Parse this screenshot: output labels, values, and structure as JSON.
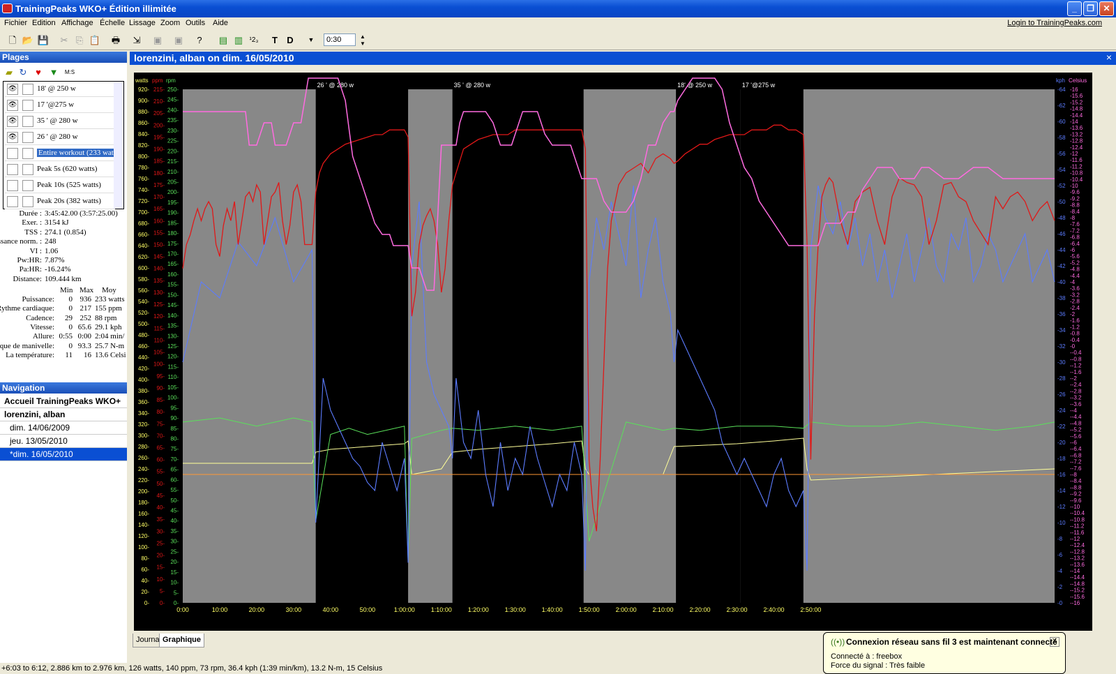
{
  "window": {
    "title": "TrainingPeaks WKO+ Édition illimitée",
    "buttons": [
      "_",
      "❐",
      "✕"
    ]
  },
  "menu": {
    "items": [
      "Fichier",
      "Edition",
      "Affichage",
      "Échelle",
      "Lissage",
      "Zoom",
      "Outils",
      "Aide"
    ],
    "login": "Login to TrainingPeaks.com"
  },
  "toolbar": {
    "zoom_value": "0:30",
    "text_t": "T",
    "text_d": "D",
    "num_icon": "¹2₃"
  },
  "ranges": {
    "title": "Plages",
    "tool_ms": "M:S",
    "items": [
      {
        "label": "18' @ 250 w",
        "eye": "👁"
      },
      {
        "label": "17 '@275 w",
        "eye": "👁"
      },
      {
        "label": "35 ' @ 280 w",
        "eye": "👁"
      },
      {
        "label": "26 ' @ 280 w",
        "eye": "👁"
      },
      {
        "label": "Entire workout (233 watt",
        "eye": ""
      },
      {
        "label": "Peak 5s (620 watts)",
        "eye": ""
      },
      {
        "label": "Peak 10s (525 watts)",
        "eye": ""
      },
      {
        "label": "Peak 20s (382 watts)",
        "eye": ""
      }
    ]
  },
  "summary": [
    {
      "label": "Durée :",
      "value": "3:45:42.00 (3:57:25.00)"
    },
    {
      "label": "Exer. :",
      "value": "3154 kJ"
    },
    {
      "label": "TSS :",
      "value": "274.1 (0.854)"
    },
    {
      "label": "ssance norm. :",
      "value": "248"
    },
    {
      "label": "VI :",
      "value": "1.06"
    },
    {
      "label": "Pw:HR:",
      "value": "7.87%"
    },
    {
      "label": "Pa:HR:",
      "value": "-16.24%"
    },
    {
      "label": "Distance:",
      "value": "109.444 km"
    }
  ],
  "stats": {
    "headers": [
      "Min",
      "Max",
      "Moy"
    ],
    "rows": [
      {
        "label": "Puissance:",
        "min": "0",
        "max": "936",
        "avg": "233 watts"
      },
      {
        "label": "Rythme cardiaque:",
        "min": "0",
        "max": "217",
        "avg": "155 ppm"
      },
      {
        "label": "Cadence:",
        "min": "29",
        "max": "252",
        "avg": "88 rpm"
      },
      {
        "label": "Vitesse:",
        "min": "0",
        "max": "65.6",
        "avg": "29.1 kph"
      },
      {
        "label": "Allure:",
        "min": "0:55",
        "max": "0:00",
        "avg": "2:04 min/"
      },
      {
        "label": "rque de manivelle:",
        "min": "0",
        "max": "93.3",
        "avg": "25.7 N-m"
      },
      {
        "label": "La température:",
        "min": "11",
        "max": "16",
        "avg": "13.6 Celsi"
      }
    ]
  },
  "navigation": {
    "title": "Navigation",
    "items": [
      "Accueil TrainingPeaks WKO+",
      "lorenzini, alban",
      "dim. 14/06/2009",
      "jeu. 13/05/2010",
      "*dim. 16/05/2010"
    ]
  },
  "chart": {
    "title": "lorenzini, alban on dim. 16/05/2010",
    "close": "×",
    "tabs": [
      "Journal",
      "Graphique"
    ]
  },
  "chart_data": {
    "type": "line",
    "colors": {
      "power": "#ff6be0",
      "hr": "#e01818",
      "cadence": "#5ae05a",
      "speed": "#5c7cff",
      "torque": "#ffff99",
      "temp": "#ff9933",
      "gray": "#888888"
    },
    "axis_units": {
      "watts": "watts",
      "ppm": "ppm",
      "rpm": "rpm",
      "kph": "kph",
      "celsius": "Celsius"
    },
    "x_ticks": [
      "0:00",
      "10:00",
      "20:00",
      "30:00",
      "40:00",
      "50:00",
      "1:00:00",
      "1:10:00",
      "1:20:00",
      "1:30:00",
      "1:40:00",
      "1:50:00",
      "2:00:00",
      "2:10:00",
      "2:20:00",
      "2:30:00",
      "2:40:00",
      "2:50:00"
    ],
    "xlim_minutes": [
      0,
      236
    ],
    "watts": {
      "min": 0,
      "max": 920,
      "step": 20
    },
    "ppm": {
      "min": 0,
      "max": 215,
      "step": 5
    },
    "rpm": {
      "min": 0,
      "max": 250,
      "step": 5
    },
    "kph": {
      "min": 0,
      "max": 64,
      "step": 2
    },
    "celsius": {
      "min": -16,
      "max": 16,
      "step": 0.2
    },
    "intervals": [
      {
        "label": "26 ' @ 280 w",
        "start": 36,
        "end": 61
      },
      {
        "label": "35 ' @ 280 w",
        "start": 73,
        "end": 108.5
      },
      {
        "label": "18' @ 250 w",
        "start": 133.5,
        "end": 151
      },
      {
        "label": "17 '@275 w",
        "start": 151,
        "end": 168
      }
    ],
    "series": {
      "power": {
        "x": [
          0,
          15,
          17,
          18,
          19,
          20,
          22,
          23,
          24,
          25,
          27,
          28,
          30,
          32,
          33,
          34,
          35,
          36,
          42,
          44,
          45,
          46,
          48,
          50,
          52,
          54,
          56,
          57,
          61,
          62,
          64,
          66,
          68,
          70,
          72,
          74,
          75,
          76,
          78,
          80,
          82,
          84,
          86,
          88,
          89,
          90,
          92,
          94,
          96,
          98,
          100,
          102,
          104,
          105,
          106,
          108,
          110,
          112,
          113,
          114,
          116,
          118,
          120,
          122,
          124,
          126,
          128,
          130,
          132,
          133,
          134,
          136,
          138,
          140,
          142,
          144,
          146,
          148,
          150,
          152,
          154,
          156,
          158,
          160,
          162,
          164,
          166,
          168,
          170,
          172,
          174,
          176,
          178,
          180,
          182,
          184,
          186,
          188,
          190,
          192,
          194,
          196,
          198,
          200,
          202,
          206,
          210,
          214,
          218,
          222,
          226,
          230,
          236
        ],
        "y": [
          880,
          880,
          880,
          820,
          820,
          820,
          860,
          860,
          860,
          820,
          820,
          820,
          860,
          860,
          900,
          940,
          940,
          940,
          940,
          900,
          850,
          800,
          760,
          720,
          680,
          660,
          660,
          640,
          640,
          600,
          600,
          560,
          560,
          820,
          820,
          820,
          860,
          880,
          880,
          880,
          880,
          860,
          820,
          820,
          820,
          840,
          880,
          880,
          880,
          840,
          820,
          820,
          820,
          820,
          800,
          760,
          760,
          760,
          740,
          720,
          700,
          700,
          700,
          720,
          760,
          820,
          820,
          860,
          880,
          880,
          900,
          920,
          940,
          940,
          940,
          940,
          920,
          860,
          820,
          780,
          760,
          720,
          700,
          680,
          660,
          640,
          640,
          640,
          640,
          640,
          680,
          680,
          680,
          700,
          700,
          740,
          760,
          780,
          780,
          780,
          760,
          760,
          760,
          780,
          780,
          760,
          760,
          780,
          780,
          760,
          760,
          760,
          760
        ]
      },
      "hr": {
        "x": [
          0,
          1,
          2,
          3,
          4,
          5,
          6,
          7,
          8,
          9,
          10,
          11,
          12,
          13,
          14,
          15,
          16,
          17,
          18,
          19,
          20,
          21,
          22,
          23,
          24,
          25,
          26,
          27,
          28,
          29,
          30,
          31,
          32,
          33,
          34,
          35,
          36,
          37,
          38,
          39,
          40,
          42,
          44,
          46,
          48,
          50,
          52,
          54,
          56,
          58,
          60,
          61,
          62,
          63,
          64,
          65,
          66,
          67,
          68,
          69,
          70,
          71,
          72,
          73,
          74,
          75,
          76,
          78,
          80,
          82,
          84,
          86,
          88,
          90,
          92,
          94,
          96,
          98,
          100,
          102,
          104,
          106,
          108,
          109,
          110,
          111,
          112,
          113,
          114,
          115,
          116,
          118,
          120,
          122,
          124,
          126,
          128,
          130,
          132,
          133,
          134,
          136,
          138,
          140,
          142,
          144,
          146,
          148,
          150,
          152,
          154,
          156,
          158,
          160,
          162,
          164,
          166,
          168,
          169,
          170,
          171,
          172,
          173,
          174,
          175,
          176,
          178,
          180,
          182,
          184,
          186,
          188,
          190,
          192,
          194,
          196,
          198,
          200,
          202,
          204,
          206,
          208,
          210,
          212,
          214,
          216,
          218,
          220,
          222,
          224,
          226,
          228,
          230,
          232,
          234,
          236
        ],
        "y": [
          140,
          150,
          154,
          160,
          165,
          160,
          165,
          168,
          165,
          150,
          145,
          158,
          165,
          160,
          168,
          150,
          160,
          170,
          172,
          168,
          175,
          172,
          150,
          160,
          170,
          172,
          176,
          160,
          150,
          158,
          172,
          175,
          168,
          150,
          150,
          150,
          172,
          180,
          184,
          186,
          188,
          190,
          192,
          193,
          194,
          195,
          196,
          196,
          198,
          198,
          198,
          195,
          120,
          130,
          150,
          158,
          162,
          165,
          160,
          150,
          130,
          140,
          160,
          175,
          180,
          185,
          190,
          192,
          194,
          195,
          196,
          196,
          196,
          198,
          198,
          198,
          198,
          198,
          198,
          198,
          198,
          198,
          198,
          190,
          60,
          40,
          30,
          60,
          100,
          140,
          160,
          175,
          180,
          182,
          184,
          180,
          186,
          188,
          186,
          184,
          185,
          188,
          190,
          192,
          192,
          194,
          195,
          196,
          196,
          196,
          198,
          198,
          198,
          200,
          200,
          198,
          198,
          196,
          150,
          60,
          120,
          150,
          170,
          175,
          178,
          176,
          160,
          150,
          168,
          172,
          174,
          160,
          150,
          170,
          178,
          176,
          175,
          170,
          150,
          160,
          175,
          176,
          170,
          168,
          160,
          155,
          150,
          170,
          165,
          170,
          172,
          168,
          160,
          165,
          168,
          160
        ]
      },
      "cadence": {
        "x": [
          0,
          10,
          20,
          30,
          35,
          36,
          40,
          45,
          50,
          55,
          60,
          61,
          62,
          70,
          73,
          80,
          90,
          100,
          108,
          110,
          120,
          130,
          133,
          140,
          150,
          160,
          168,
          170,
          180,
          190,
          200,
          210,
          220,
          230,
          236
        ],
        "y": [
          88,
          90,
          86,
          90,
          88,
          40,
          82,
          85,
          82,
          84,
          86,
          20,
          80,
          84,
          85,
          84,
          86,
          84,
          86,
          30,
          88,
          84,
          85,
          84,
          86,
          86,
          85,
          88,
          86,
          86,
          88,
          86,
          84,
          86,
          88
        ]
      },
      "speed": {
        "x": [
          0,
          5,
          10,
          15,
          20,
          25,
          30,
          35,
          36,
          38,
          40,
          42,
          44,
          46,
          48,
          50,
          52,
          54,
          56,
          58,
          60,
          61,
          62,
          64,
          66,
          68,
          70,
          72,
          73,
          74,
          76,
          78,
          80,
          82,
          84,
          86,
          88,
          90,
          92,
          94,
          96,
          98,
          100,
          102,
          104,
          106,
          108,
          109,
          110,
          112,
          114,
          116,
          118,
          120,
          122,
          124,
          126,
          128,
          130,
          132,
          133,
          134,
          136,
          138,
          140,
          142,
          144,
          146,
          148,
          150,
          152,
          154,
          156,
          158,
          160,
          162,
          164,
          166,
          168,
          169,
          170,
          172,
          174,
          176,
          178,
          180,
          182,
          184,
          186,
          188,
          190,
          192,
          194,
          196,
          198,
          200,
          202,
          204,
          206,
          208,
          210,
          212,
          214,
          216,
          218,
          220,
          222,
          224,
          226,
          228,
          230,
          232,
          234,
          236
        ],
        "y": [
          30,
          40,
          38,
          45,
          42,
          48,
          40,
          44,
          10,
          28,
          24,
          22,
          20,
          18,
          17,
          15,
          14,
          20,
          17,
          14,
          18,
          5,
          42,
          50,
          30,
          26,
          24,
          22,
          18,
          28,
          20,
          18,
          24,
          16,
          12,
          20,
          14,
          18,
          16,
          22,
          18,
          15,
          12,
          16,
          14,
          20,
          16,
          4,
          40,
          48,
          44,
          50,
          46,
          42,
          52,
          38,
          44,
          48,
          40,
          36,
          30,
          34,
          32,
          30,
          28,
          26,
          24,
          20,
          18,
          16,
          18,
          16,
          14,
          12,
          16,
          18,
          14,
          12,
          14,
          4,
          44,
          52,
          48,
          46,
          50,
          44,
          48,
          42,
          46,
          40,
          44,
          38,
          42,
          46,
          40,
          44,
          48,
          42,
          40,
          46,
          44,
          48,
          40,
          42,
          46,
          44,
          40,
          42,
          44,
          46,
          40,
          42,
          44,
          40
        ]
      },
      "torque": {
        "x": [
          0,
          35,
          36,
          40,
          50,
          60,
          61,
          62,
          70,
          73,
          80,
          90,
          100,
          108,
          109,
          110,
          120,
          130,
          133,
          140,
          150,
          160,
          168,
          169,
          170,
          236
        ],
        "y": [
          250,
          250,
          270,
          275,
          280,
          285,
          290,
          230,
          240,
          270,
          275,
          280,
          285,
          290,
          240,
          230,
          230,
          230,
          280,
          282,
          285,
          290,
          295,
          240,
          220,
          240
        ]
      },
      "temp": {
        "x": [
          0,
          20,
          35,
          36,
          60,
          61,
          62,
          72,
          73,
          108,
          109,
          110,
          132,
          133,
          168,
          169,
          170,
          236
        ],
        "y": [
          -8,
          -8,
          -8,
          -8,
          -8,
          -8,
          -8,
          -8,
          -8,
          -8,
          -8,
          -8,
          -8,
          -8,
          -8,
          -8,
          -8,
          -8
        ]
      }
    }
  },
  "status": "+6:03 to 6:12, 2.886 km to 2.976 km, 126 watts, 140 ppm, 73 rpm, 36.4 kph (1:39 min/km), 13.2 N-m, 15 Celsius",
  "balloon": {
    "title": "Connexion réseau sans fil 3 est maintenant connecté",
    "line1": "Connecté à : freebox",
    "line2": "Force du signal : Très faible",
    "close": "X"
  }
}
